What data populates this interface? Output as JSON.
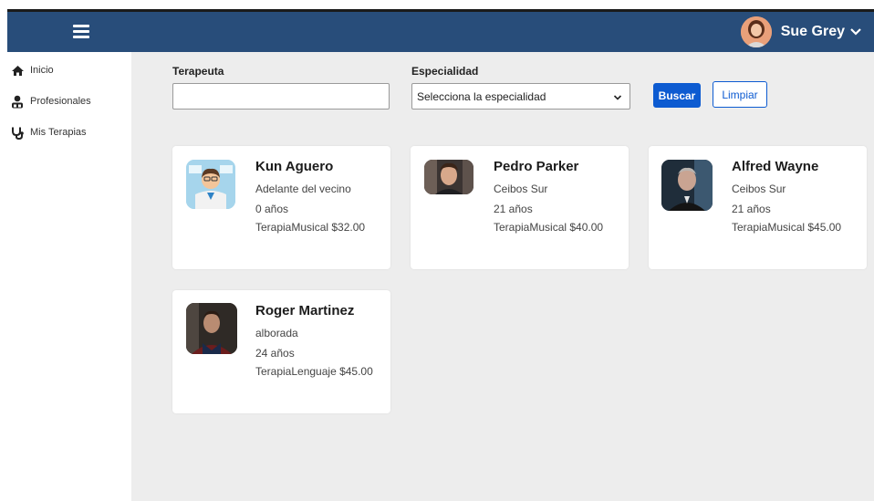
{
  "header": {
    "user_name": "Sue Grey",
    "bar_color": "#284d7a"
  },
  "sidebar": {
    "items": [
      {
        "label": "Inicio",
        "icon": "home-icon"
      },
      {
        "label": "Profesionales",
        "icon": "people-icon"
      },
      {
        "label": "Mis Terapias",
        "icon": "stethoscope-icon"
      }
    ]
  },
  "filters": {
    "therapist_label": "Terapeuta",
    "therapist_value": "",
    "specialty_label": "Especialidad",
    "specialty_value": "Selecciona la especialidad",
    "search_label": "Buscar",
    "clear_label": "Limpiar"
  },
  "professionals": [
    {
      "name": "Kun Aguero",
      "location": "Adelante del vecino",
      "age": "0 años",
      "therapy": "TerapiaMusical $32.00",
      "photo": "doctor-cartoon-avatar"
    },
    {
      "name": "Pedro Parker",
      "location": "Ceibos Sur",
      "age": "21 años",
      "therapy": "TerapiaMusical $40.00",
      "photo": "person-photo"
    },
    {
      "name": "Alfred Wayne",
      "location": "Ceibos Sur",
      "age": "21 años",
      "therapy": "TerapiaMusical $45.00",
      "photo": "person-photo"
    },
    {
      "name": "Roger Martinez",
      "location": "alborada",
      "age": "24 años",
      "therapy": "TerapiaLenguaje $45.00",
      "photo": "person-photo"
    }
  ],
  "colors": {
    "primary": "#0d5bd1",
    "background": "#ededed"
  }
}
